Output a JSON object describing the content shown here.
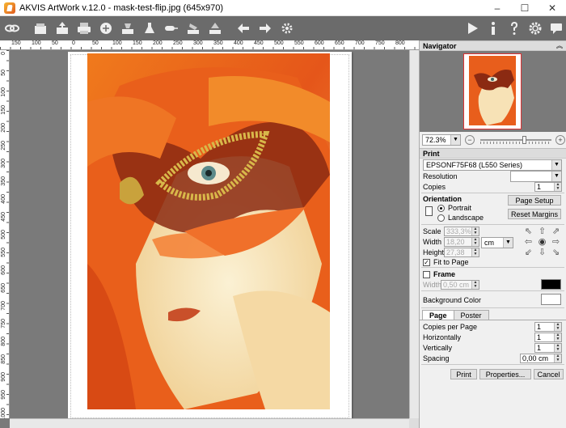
{
  "window": {
    "title": "AKVIS ArtWork v.12.0 - mask-test-flip.jpg (645x970)",
    "minimize": "–",
    "maximize": "☐",
    "close": "✕"
  },
  "toolbar": {
    "left_icons": [
      "link-icon",
      "open-icon",
      "save-icon",
      "print-icon",
      "share-icon",
      "batch-icon",
      "brush-icon",
      "eraser-icon",
      "history-icon",
      "undo-icon",
      "redo-icon",
      "settings-gear-icon"
    ],
    "right_icons": [
      "run-icon",
      "info-icon",
      "help-icon",
      "preferences-icon",
      "feedback-icon"
    ]
  },
  "rulers": {
    "h_labels": [
      "150",
      "100",
      "50",
      "0",
      "50",
      "100",
      "150",
      "200",
      "250",
      "300",
      "350",
      "400",
      "450",
      "500",
      "550",
      "600",
      "650",
      "700",
      "750",
      "800"
    ],
    "v_labels": [
      "0",
      "50",
      "100",
      "150",
      "200",
      "250",
      "300",
      "350",
      "400",
      "450",
      "500",
      "550",
      "600",
      "650",
      "700",
      "750",
      "800",
      "850",
      "900",
      "950",
      "1000"
    ]
  },
  "navigator": {
    "title": "Navigator",
    "zoom": "72.3%",
    "zoom_level": 0.62
  },
  "print": {
    "title": "Print",
    "printer": "EPSONF75F68 (L550 Series)",
    "resolution_label": "Resolution",
    "resolution_value": "",
    "copies_label": "Copies",
    "copies_value": "1",
    "orientation_label": "Orientation",
    "portrait": "Portrait",
    "landscape": "Landscape",
    "page_setup": "Page Setup",
    "reset_margins": "Reset Margins",
    "scale_label": "Scale",
    "scale_value": "333,3%",
    "width_label": "Width",
    "width_value": "18,20",
    "height_label": "Height",
    "height_value": "27,38",
    "unit": "cm",
    "fit_to_page": "Fit to Page"
  },
  "frame": {
    "title": "Frame",
    "width_label": "Width",
    "width_value": "0,50 cm",
    "frame_color": "#000000",
    "background_label": "Background Color",
    "background_color": "#ffffff"
  },
  "page_tabs": {
    "tab_page": "Page",
    "tab_poster": "Poster",
    "copies_per_page_label": "Copies per Page",
    "copies_per_page_value": "1",
    "horizontally_label": "Horizontally",
    "horizontally_value": "1",
    "vertically_label": "Vertically",
    "vertically_value": "1",
    "spacing_label": "Spacing",
    "spacing_value": "0,00 cm"
  },
  "footer": {
    "print": "Print",
    "properties": "Properties...",
    "cancel": "Cancel"
  },
  "colors": {
    "toolbar_bg": "#6b6b6b",
    "workspace_bg": "#7a7a7a",
    "panel_bg": "#f0f0f0"
  }
}
